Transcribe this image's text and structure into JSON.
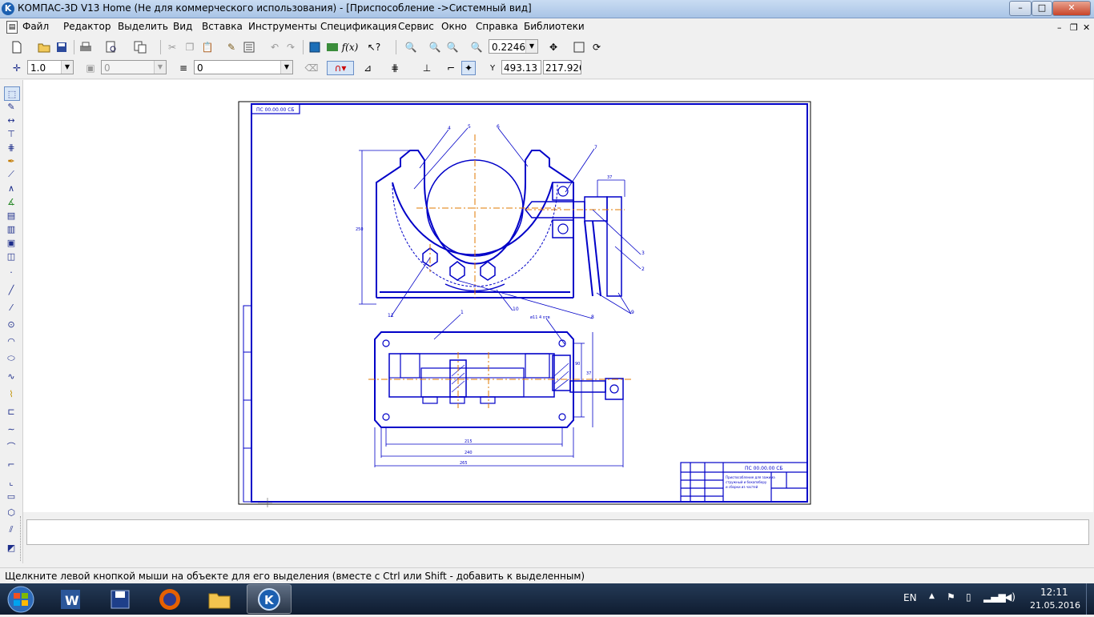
{
  "window": {
    "title": "КОМПАС-3D V13 Home (Не для коммерческого использования) - [Приспособление ->Системный вид]",
    "app_icon_glyph": "K",
    "controls": {
      "minimize": "–",
      "maximize": "□",
      "close": "✕"
    }
  },
  "menubar": {
    "items": [
      "Файл",
      "Редактор",
      "Выделить",
      "Вид",
      "Вставка",
      "Инструменты",
      "Спецификация",
      "Сервис",
      "Окно",
      "Справка",
      "Библиотеки"
    ],
    "mdi_controls": {
      "minimize": "–",
      "restore": "❐",
      "close": "✕"
    }
  },
  "toolbar_standard": {
    "icons": [
      "new-document-icon",
      "open-icon",
      "save-icon",
      "print-icon",
      "preview-icon",
      "print-setup-icon",
      "cut-icon",
      "copy-icon",
      "paste-icon",
      "format-painter-icon",
      "properties-icon",
      "undo-icon",
      "redo-icon",
      "manager-icon",
      "library-icon",
      "variables-icon",
      "help-pointer-icon"
    ],
    "zoom_value": "0.2246"
  },
  "toolbar_current_state": {
    "step_value": "1.0",
    "layer_value": "0",
    "style_value": "0",
    "coord_x": "493.13",
    "coord_y": "217.920"
  },
  "left_toolbar": {
    "icons": [
      "select-icon",
      "geometry-icon",
      "dimensions-icon",
      "symbols-icon",
      "editing-icon",
      "parametrization-icon",
      "measure-icon",
      "selection-icon",
      "associative-view-icon",
      "spec-icon",
      "report-icon",
      "insert-icon",
      "fragment-icon",
      "point-icon",
      "auxiliary-line-icon",
      "segment-icon",
      "circle-icon",
      "arc-icon",
      "ellipse-icon",
      "spline-icon",
      "polyline-icon",
      "hatch-icon",
      "contour-icon",
      "bezier-icon",
      "chamfer-icon",
      "fillet-icon",
      "rectangle-icon",
      "polygon-icon",
      "equidistant-icon",
      "fill-icon"
    ]
  },
  "drawing": {
    "stamp_code": "ПС 00.00.00 СБ",
    "top_left_code": "ПС 00.00.00 СБ",
    "title_text": "Приспособление для зажима",
    "title_text_2": "стружный и бокапобору",
    "title_text_3": "и сборки из частей",
    "leader_numbers": [
      "1",
      "2",
      "3",
      "4",
      "5",
      "6",
      "7",
      "8",
      "9",
      "10",
      "11"
    ],
    "dims": [
      "215",
      "240",
      "250",
      "265",
      "37",
      "37",
      "90"
    ],
    "note_holes": "ø11 4 отв"
  },
  "statusbar": {
    "hint": "Щелкните левой кнопкой мыши на объекте для его выделения (вместе с Ctrl или Shift - добавить к выделенным)"
  },
  "taskbar": {
    "buttons": [
      "word-icon",
      "save-disk-icon",
      "firefox-icon",
      "explorer-folder-icon",
      "kompas-icon"
    ],
    "lang": "EN",
    "time": "12:11",
    "date": "21.05.2016"
  },
  "colors": {
    "drawing_blue": "#0000c8",
    "axis_orange": "#e07800",
    "titlebar": "#b9d1ef",
    "taskbar": "#1b2d47"
  }
}
